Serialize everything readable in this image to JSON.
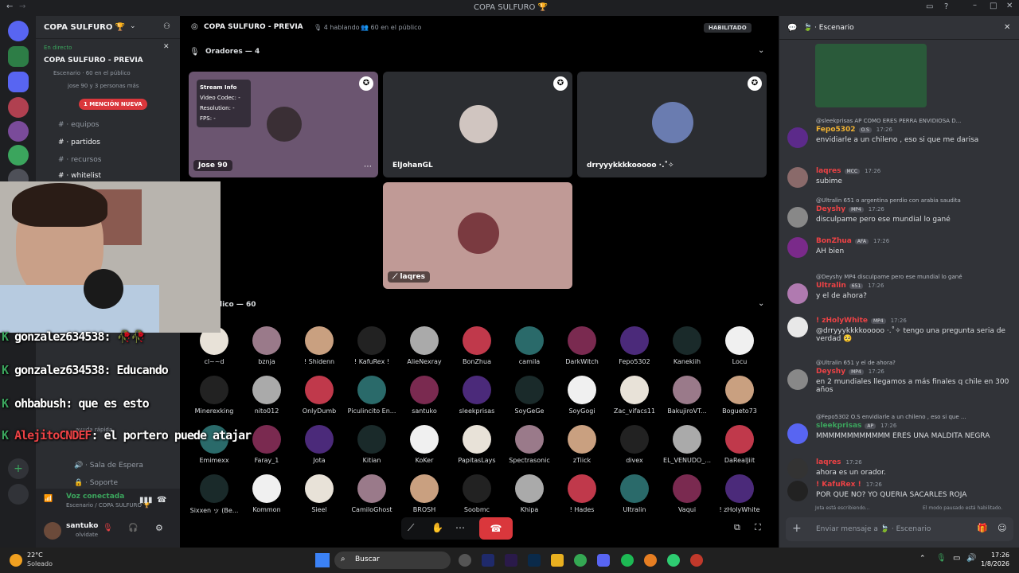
{
  "window": {
    "title": "COPA SULFURO 🏆"
  },
  "server": {
    "name": "COPA SULFURO 🏆"
  },
  "live_panel": {
    "badge": "En directo",
    "title": "COPA SULFURO - PREVIA",
    "line1": "Escenario · 60 en el público",
    "line2": "jose 90 y 3 personas más"
  },
  "mention_pill": "1 MENCIÓN NUEVA",
  "channels": [
    "equipos",
    "partidos",
    "recursos",
    "whitelist",
    "ayuda rápida",
    "abrir-ticket",
    "Sala de Espera",
    "Soporte"
  ],
  "voice": {
    "status": "Voz conectada",
    "location": "Escenario / COPA SULFURO 🏆"
  },
  "user": {
    "name": "santuko",
    "status": "olvidate"
  },
  "stage": {
    "title": "COPA SULFURO - PREVIA",
    "speaking": "4 hablando",
    "audience_count": "60 en el público",
    "badge": "HABILITADO",
    "speakers_header": "Oradores — 4",
    "audience_header": "lico — 60"
  },
  "stream_info": {
    "title": "Stream Info",
    "video_codec_label": "Video Codec:",
    "video_codec": "-",
    "resolution_label": "Resolution:",
    "resolution": "-",
    "fps_label": "FPS:",
    "fps": "-"
  },
  "speakers": [
    {
      "name": "Jose 90",
      "bg": "#6b5570"
    },
    {
      "name": "ElJohanGL",
      "bg": "#2b2d31"
    },
    {
      "name": "drryyykkkkooooo ·.˚✧",
      "bg": "#2b2d31"
    },
    {
      "name": "laqres",
      "bg": "#c09a96"
    }
  ],
  "audience": [
    [
      "cl~~d",
      "bznja",
      "! Shidenn",
      "! KafuRex !",
      "AlieNexray",
      "BonZhua",
      "camila",
      "DarkWitch",
      "Fepo5302",
      "Kanekiih",
      "Locu"
    ],
    [
      "Minerexking",
      "nito012",
      "OnlyDumb",
      "Piculincito En...",
      "santuko",
      "sleekprisas",
      "SoyGeGe",
      "SoyGogi",
      "Zac_vifacs11",
      "BakujiroVT...",
      "Bogueto73"
    ],
    [
      "Emimexx",
      "Faray_1",
      "Jota",
      "Kitian",
      "KoKer",
      "PapitasLays",
      "Spectrasonic",
      "zTiick",
      "divex",
      "EL_VENUDO_...",
      "DaRealJiit"
    ],
    [
      "Sixxen ッ (Be...",
      "Kommon",
      "Sieel",
      "CamiloGhost",
      "BROSH",
      "Soobmc",
      "Khipa",
      "! Hades",
      "Ultralin",
      "Vaqui",
      "! zHolyWhite"
    ]
  ],
  "overlay_chat": [
    {
      "user": "gonzalez634538",
      "text": ": 🥀🥀"
    },
    {
      "user": "gonzalez634538",
      "text": ": Educando"
    },
    {
      "user": "ohbabush",
      "text": ": que es esto"
    },
    {
      "user": "AlejitoCNDEF",
      "text": ": el portero puede atajar"
    }
  ],
  "chat": {
    "header": "Escenario",
    "messages": [
      {
        "reply": "@sleekprisas AP COMO ERES PERRA ENVIDIOSA D...",
        "user": "Fepo5302",
        "tag": "O.S",
        "time": "17:26",
        "text": "envidiarle a un chileno , eso si que me darisa",
        "color": "#f0b232"
      },
      {
        "reply": "",
        "user": "laqres",
        "tag": "MCC",
        "time": "17:26",
        "text": "subime",
        "color": "#ed4245"
      },
      {
        "reply": "@Ultralin 651 o argentina perdio con arabia saudita",
        "user": "Deyshy",
        "tag": "MP4",
        "time": "17:26",
        "text": "disculpame pero ese mundial lo gané",
        "color": "#ed4245"
      },
      {
        "reply": "",
        "user": "BonZhua",
        "tag": "AFA",
        "time": "17:26",
        "text": "AH bien",
        "color": "#ed4245"
      },
      {
        "reply": "@Deyshy MP4 disculpame pero ese mundial lo gané",
        "user": "Ultralin",
        "tag": "651",
        "time": "17:26",
        "text": "y el de ahora?",
        "color": "#ed4245"
      },
      {
        "reply": "",
        "user": "! zHolyWhite",
        "tag": "MP4",
        "time": "17:26",
        "text": "@drryyykkkkooooo ·.˚✧ tengo una pregunta seria de verdad 🥺",
        "color": "#ed4245"
      },
      {
        "reply": "@Ultralin 651 y el de ahora?",
        "user": "Deyshy",
        "tag": "MP4",
        "time": "17:26",
        "text": "en 2 mundiales llegamos a más finales q chile en 300 años",
        "color": "#ed4245"
      },
      {
        "reply": "@Fepo5302 O.S envidiarle a un chileno , eso si que ...",
        "user": "sleekprisas",
        "tag": "AP",
        "time": "17:26",
        "text": "MMMMMMMMMMMM ERES UNA MALDITA NEGRA",
        "color": "#3ba55d"
      },
      {
        "reply": "",
        "user": "laqres",
        "tag": "",
        "time": "17:26",
        "text": "ahora es un orador.",
        "color": "#ed4245"
      },
      {
        "reply": "",
        "user": "! KafuRex !",
        "tag": "",
        "time": "17:26",
        "text": "POR QUE NO? YO QUERIA SACARLES ROJA",
        "color": "#ed4245"
      }
    ],
    "typing": "Jota está escribiendo...",
    "slowmode": "El modo pausado está habilitado.",
    "input_placeholder": "Enviar mensaje a 🍃 · Escenario"
  },
  "taskbar": {
    "weather_temp": "22°C",
    "weather_desc": "Soleado",
    "search": "Buscar",
    "time": "17:26",
    "date": "1/8/2026"
  }
}
